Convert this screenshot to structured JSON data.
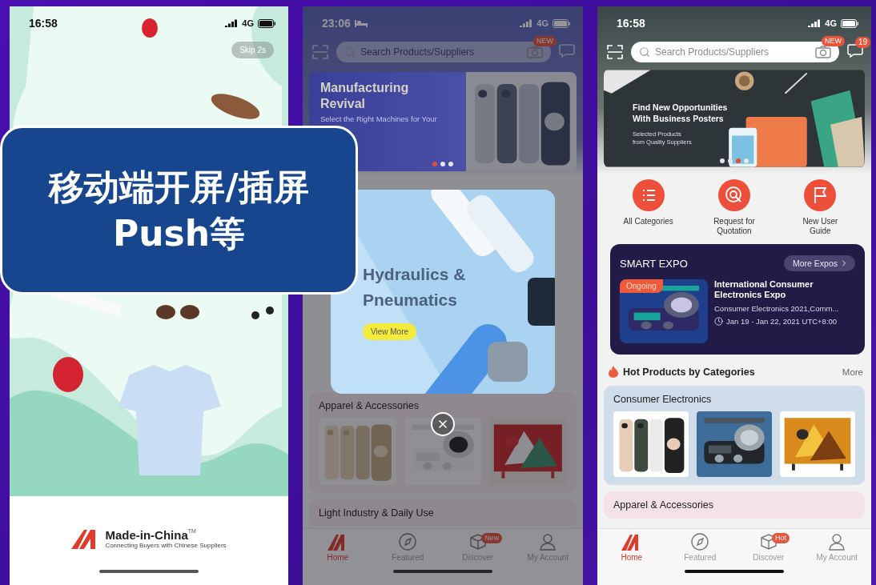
{
  "overlay_label": {
    "lines": [
      "移动端开屏/插屏",
      "Push等"
    ]
  },
  "splash_screen": {
    "status_bar": {
      "time": "16:58",
      "network": "4G"
    },
    "skip_button": "Skip 2s",
    "logo": {
      "name": "Made-in-China",
      "trademark": "TM",
      "tagline": "Connecting Buyers with Chinese Suppliers"
    }
  },
  "popup_screen": {
    "status_bar": {
      "time": "23:06",
      "network": "4G",
      "sleep_mode": true
    },
    "search": {
      "placeholder": "Search Products/Suppliers",
      "camera_badge": "NEW"
    },
    "banner": {
      "title": "Manufacturing Revival",
      "subtitle": "Select the Right Machines for Your",
      "dots": [
        {
          "selected": true
        },
        {
          "selected": false
        },
        {
          "selected": false
        }
      ]
    },
    "categories": [
      {
        "title": "Apparel & Accessories"
      },
      {
        "title": "Light Industry & Daily Use"
      }
    ],
    "tab_bar": [
      {
        "label": "Home",
        "selected": true
      },
      {
        "label": "Featured",
        "selected": false
      },
      {
        "label": "Discover",
        "selected": false,
        "badge": "New"
      },
      {
        "label": "My Account",
        "selected": false
      }
    ],
    "popup": {
      "title_lines": [
        "Hydraulics &",
        "Pneumatics"
      ],
      "button": "View More"
    }
  },
  "home_screen": {
    "status_bar": {
      "time": "16:58",
      "network": "4G"
    },
    "search": {
      "placeholder": "Search Products/Suppliers",
      "camera_badge": "NEW",
      "message_badge": "19"
    },
    "banner": {
      "title_lines": [
        "Find New Opportunities",
        "With Business Posters"
      ],
      "subtitle_lines": [
        "Selected Products",
        "from Quality Suppliers"
      ],
      "dots": [
        {
          "selected": false
        },
        {
          "selected": false
        },
        {
          "selected": true
        },
        {
          "selected": false
        }
      ]
    },
    "shortcuts": [
      "All Categories",
      "Request for Quotation",
      "New User Guide"
    ],
    "expo": {
      "title": "SMART EXPO",
      "more_button": "More Expos",
      "status": "Ongoing",
      "name": "International Consumer Electronics Expo",
      "category": "Consumer Electronics 2021,Comm...",
      "date": "Jan 19 - Jan 22, 2021 UTC+8:00"
    },
    "hot_products": {
      "title": "Hot Products by Categories",
      "more": "More"
    },
    "categories": [
      {
        "title": "Consumer Electronics",
        "color": "#cfdcea"
      },
      {
        "title": "Apparel & Accessories",
        "color": "#f3e3e6"
      }
    ],
    "tab_bar": [
      {
        "label": "Home",
        "selected": true
      },
      {
        "label": "Featured",
        "selected": false
      },
      {
        "label": "Discover",
        "selected": false,
        "badge": "Hot"
      },
      {
        "label": "My Account",
        "selected": false
      }
    ]
  }
}
